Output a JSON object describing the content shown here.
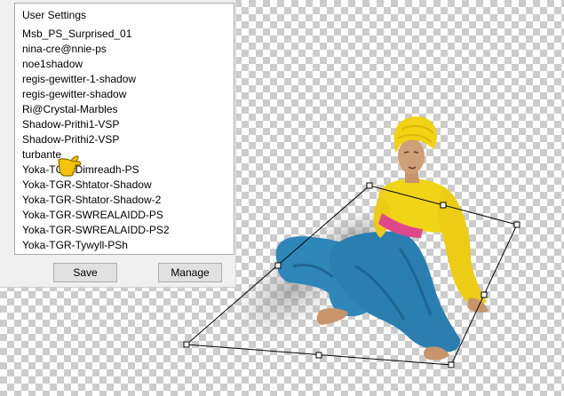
{
  "panel": {
    "title": "User Settings",
    "items": [
      "Msb_PS_Surprised_01",
      "nina-cre@nnie-ps",
      "noe1shadow",
      "regis-gewitter-1-shadow",
      "regis-gewitter-shadow",
      "Ri@Crystal-Marbles",
      "Shadow-Prithi1-VSP",
      "Shadow-Prithi2-VSP",
      "turbante",
      "Yoka-TGR-Dimreadh-PS",
      "Yoka-TGR-Shtator-Shadow",
      "Yoka-TGR-Shtator-Shadow-2",
      "Yoka-TGR-SWREALAIDD-PS",
      "Yoka-TGR-SWREALAIDD-PS2",
      "Yoka-TGR-Tywyll-PSh"
    ],
    "save_label": "Save",
    "manage_label": "Manage"
  },
  "colors": {
    "turban": "#f2d214",
    "blouse": "#f0d418",
    "pants": "#2f86b8",
    "sash": "#e0488c",
    "skin": "#c7946b"
  },
  "icons": {
    "cursor": "pointing-hand-icon"
  }
}
